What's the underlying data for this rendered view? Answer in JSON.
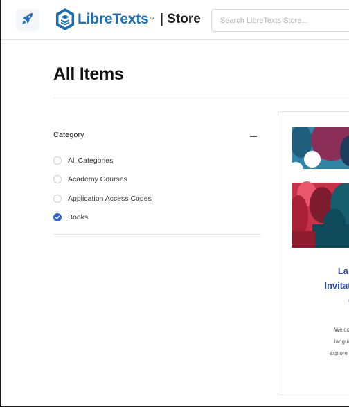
{
  "header": {
    "logo_text": "LibreTexts",
    "logo_tm": "™",
    "store_label": "| Store",
    "search_placeholder": "Search LibreTexts Store...",
    "icons": {
      "home": "rocket-icon",
      "logo": "libretexts-logo-icon"
    }
  },
  "page": {
    "title": "All Items"
  },
  "filters": {
    "category_title": "Category",
    "collapse_icon": "minus-icon",
    "options": [
      {
        "label": "All Categories",
        "checked": false
      },
      {
        "label": "Academy Courses",
        "checked": false
      },
      {
        "label": "Application Access Codes",
        "checked": false
      },
      {
        "label": "Books",
        "checked": true
      }
    ]
  },
  "product": {
    "title_lines": [
      "Languag",
      "Invitation to",
      "(remix"
    ],
    "desc_lines": [
      "Welcome! This a",
      "language and co",
      "explore the founda"
    ],
    "image_icon": "silhouette-heads-image"
  },
  "colors": {
    "brand_blue": "#1f6fb5",
    "accent_blue": "#2f63d7",
    "title_blue": "#2b4eb5"
  }
}
